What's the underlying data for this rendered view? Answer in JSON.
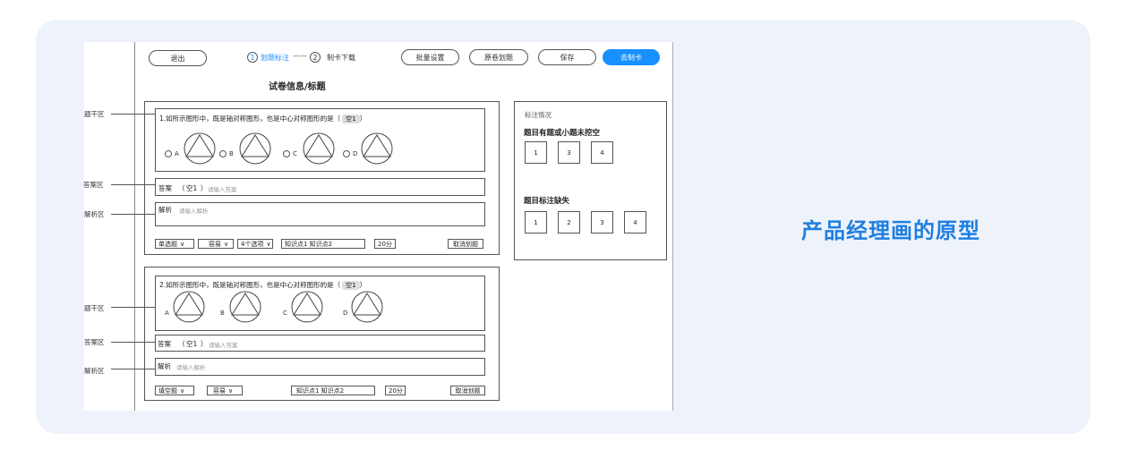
{
  "header": {
    "exit_label": "退出",
    "steps": [
      {
        "num": "1",
        "label": "划题标注"
      },
      {
        "num": "2",
        "label": "制卡下载"
      }
    ],
    "step_separator": "——",
    "batch_settings_label": "批量设置",
    "original_paper_label": "原卷划题",
    "save_label": "保存",
    "make_card_label": "去制卡"
  },
  "page_title": "试卷信息/标题",
  "side_labels": {
    "stem": "题干区",
    "answer": "答案区",
    "analysis": "解析区"
  },
  "questions": [
    {
      "stem": "1.如所示图形中，既是轴对称图形，也是中心对称图形的是（",
      "stem_end": "）",
      "blank": "空1",
      "options": [
        "A",
        "B",
        "C",
        "D"
      ],
      "answer_label": "答案",
      "answer_blank_prefix": "（",
      "answer_blank": "空1",
      "answer_blank_suffix": "）",
      "answer_placeholder": "请输入答案",
      "analysis_label": "解析",
      "analysis_placeholder": "请输入解析",
      "type": "单选题",
      "difficulty": "容易",
      "option_count": "4个选项",
      "knowledge": "知识点1  知识点2",
      "score": "20分",
      "cancel_label": "取消划题"
    },
    {
      "stem": "2.如所示图形中，既是轴对称图形，也是中心对称图形的是（",
      "stem_end": "）",
      "blank": "空1",
      "options": [
        "A",
        "B",
        "C",
        "D"
      ],
      "answer_label": "答案",
      "answer_blank_prefix": "（",
      "answer_blank": "空1",
      "answer_blank_suffix": "）",
      "answer_placeholder": "请输入答案",
      "analysis_label": "解析",
      "analysis_placeholder": "请输入解析",
      "type": "填空题",
      "difficulty": "容易",
      "knowledge": "知识点1  知识点2",
      "score": "20分",
      "cancel_label": "取消划题"
    }
  ],
  "status_panel": {
    "title": "标注情况",
    "unmarked_blanks_heading": "题目有题或小题未挖空",
    "unmarked_blanks": [
      "1",
      "3",
      "4"
    ],
    "missing_marks_heading": "题目标注缺失",
    "missing_marks": [
      "1",
      "2",
      "3",
      "4"
    ]
  },
  "headline": "产品经理画的原型",
  "colors": {
    "accent": "#1890ff",
    "headline": "#1f7fe0",
    "panel_bg": "#eef3fb"
  }
}
